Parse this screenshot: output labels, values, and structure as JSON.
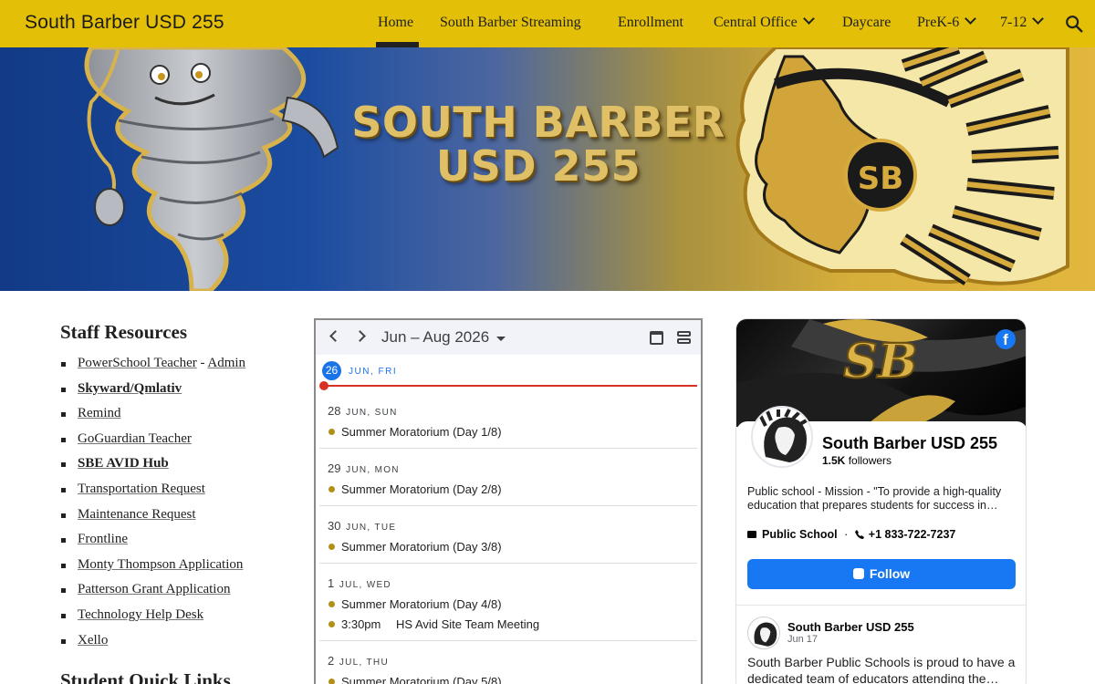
{
  "site": {
    "title": "South Barber USD 255"
  },
  "nav": {
    "items": [
      {
        "label": "Home"
      },
      {
        "label": "South Barber Streaming"
      },
      {
        "label": "Enrollment"
      },
      {
        "label": "Central Office"
      },
      {
        "label": "Daycare"
      },
      {
        "label": "PreK-6"
      },
      {
        "label": "7-12"
      }
    ],
    "active": "Home"
  },
  "hero": {
    "line1": "SOUTH BARBER",
    "line2": "USD 255",
    "logo_text": "SB"
  },
  "staff": {
    "heading": "Staff Resources",
    "items": [
      {
        "label": "PowerSchool Teacher",
        "extra": "Admin"
      },
      {
        "label": "Skyward/Qmlativ",
        "bold": true
      },
      {
        "label": "Remind"
      },
      {
        "label": "GoGuardian Teacher"
      },
      {
        "label": "SBE AVID Hub",
        "bold": true
      },
      {
        "label": "Transportation Request"
      },
      {
        "label": "Maintenance Request"
      },
      {
        "label": "Frontline"
      },
      {
        "label": "Monty Thompson Application"
      },
      {
        "label": "Patterson Grant Application"
      },
      {
        "label": "Technology Help Desk"
      },
      {
        "label": "Xello"
      }
    ],
    "next_heading": "Student Quick Links"
  },
  "calendar": {
    "range": "Jun – Aug 2026",
    "today": {
      "num": "26",
      "label": "JUN, FRI"
    },
    "days": [
      {
        "num": "28",
        "dow": "JUN, SUN",
        "events": [
          {
            "time": "",
            "title": "Summer Moratorium (Day 1/8)"
          }
        ]
      },
      {
        "num": "29",
        "dow": "JUN, MON",
        "events": [
          {
            "time": "",
            "title": "Summer Moratorium (Day 2/8)"
          }
        ]
      },
      {
        "num": "30",
        "dow": "JUN, TUE",
        "events": [
          {
            "time": "",
            "title": "Summer Moratorium (Day 3/8)"
          }
        ]
      },
      {
        "num": "1",
        "dow": "JUL, WED",
        "events": [
          {
            "time": "",
            "title": "Summer Moratorium (Day 4/8)"
          },
          {
            "time": "3:30pm",
            "title": "HS Avid Site Team Meeting"
          }
        ]
      },
      {
        "num": "2",
        "dow": "JUL, THU",
        "events": [
          {
            "time": "",
            "title": "Summer Moratorium (Day 5/8)"
          }
        ]
      }
    ],
    "event_color": "#b29016",
    "today_color": "#1a73e8",
    "now_line_color": "#d93025"
  },
  "facebook": {
    "page_name": "South Barber USD 255",
    "followers_count": "1.5K",
    "followers_label": "followers",
    "about": "Public school - Mission - \"To provide a high-quality education that prepares students for success in…",
    "category": "Public School",
    "phone": "+1 833-722-7237",
    "follow_label": "Follow",
    "cover_text": "SB",
    "post": {
      "author": "South Barber USD 255",
      "date": "Jun 17",
      "text": "South Barber Public Schools is proud to have a dedicated team of educators attending the…"
    },
    "brand_color": "#1877f2"
  },
  "colors": {
    "topbar": "#e3c007",
    "text": "#212121"
  }
}
